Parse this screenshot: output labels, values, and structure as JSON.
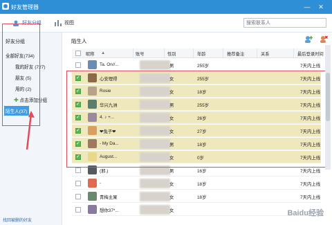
{
  "window": {
    "title": "好友管理器"
  },
  "toolbar": {
    "friends_group": "好友分组",
    "view": "视图",
    "search_placeholder": "搜索联系人"
  },
  "sidebar": {
    "header": "好友分组",
    "items": [
      {
        "label": "全部好友(734)"
      },
      {
        "label": "我的好友 (727)"
      },
      {
        "label": "朋友 (5)"
      },
      {
        "label": "用的 (2)"
      },
      {
        "label": "点击添加分组"
      },
      {
        "label": "陌生人(37)"
      }
    ],
    "footer": "找回被删的好友"
  },
  "main": {
    "title": "陌生人",
    "columns": [
      "昵称",
      "账号",
      "性别",
      "年龄",
      "推荐备注",
      "关系",
      "最后登录时间"
    ]
  },
  "rows": [
    {
      "nick": "Ta. On//...",
      "gender": "男",
      "age": "255岁",
      "last": "7天内上线",
      "checked": false,
      "hl": false,
      "av": "#6b8db4"
    },
    {
      "nick": "心安理得",
      "gender": "女",
      "age": "255岁",
      "last": "7天内上线",
      "checked": true,
      "hl": true,
      "av": "#8a6a4a"
    },
    {
      "nick": "Rosie",
      "gender": "女",
      "age": "18岁",
      "last": "7天内上线",
      "checked": true,
      "hl": true,
      "av": "#b9a28a"
    },
    {
      "nick": "华兴九洲",
      "gender": "男",
      "age": "255岁",
      "last": "7天内上线",
      "checked": true,
      "hl": true,
      "av": "#5a7d6c"
    },
    {
      "nick": "4. ♪ +...",
      "gender": "女",
      "age": "26岁",
      "last": "7天内上线",
      "checked": true,
      "hl": true,
      "av": "#9a8aa0"
    },
    {
      "nick": "❤兔子❤",
      "gender": "女",
      "age": "27岁",
      "last": "7天内上线",
      "checked": true,
      "hl": true,
      "av": "#d8a060"
    },
    {
      "nick": "- My Da...",
      "gender": "男",
      "age": "18岁",
      "last": "7天内上线",
      "checked": true,
      "hl": true,
      "av": "#a07860"
    },
    {
      "nick": "August...",
      "gender": "女",
      "age": "0岁",
      "last": "7天内上线",
      "checked": true,
      "hl": true,
      "av": "#e8d98a"
    },
    {
      "nick": "(邪.)",
      "gender": "男",
      "age": "16岁",
      "last": "7天内上线",
      "checked": false,
      "hl": false,
      "av": "#555a60"
    },
    {
      "nick": "-",
      "gender": "女",
      "age": "18岁",
      "last": "7天内上线",
      "checked": false,
      "hl": false,
      "av": "#e06a50"
    },
    {
      "nick": "青梅主果",
      "gender": "女",
      "age": "18岁",
      "last": "7天内上线",
      "checked": false,
      "hl": false,
      "av": "#6a8a70"
    },
    {
      "nick": "想你37*...",
      "gender": "女",
      "age": "",
      "last": "",
      "checked": false,
      "hl": false,
      "av": "#8a7aa0"
    }
  ],
  "watermark": "Baidu经验",
  "colors": {
    "titlebar": "#2e8fd6",
    "highlight": "#f0e8bd",
    "annotation": "#e04c5a",
    "sidebar_active": "#3f9de8"
  }
}
